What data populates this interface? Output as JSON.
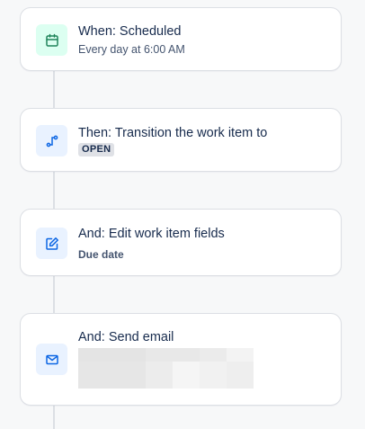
{
  "steps": [
    {
      "title": "When: Scheduled",
      "subtitle": "Every day at 6:00 AM",
      "icon": "calendar-icon",
      "icon_color": "#1f845a",
      "icon_bg": "#dcfff1"
    },
    {
      "title": "Then: Transition the work item to",
      "lozenge": "OPEN",
      "icon": "transition-icon",
      "icon_color": "#0c66e4",
      "icon_bg": "#e9f2ff"
    },
    {
      "title": "And: Edit work item fields",
      "subtitle": "Due date",
      "icon": "edit-icon",
      "icon_color": "#0c66e4",
      "icon_bg": "#e9f2ff"
    },
    {
      "title": "And: Send email",
      "icon": "email-icon",
      "icon_color": "#0c66e4",
      "icon_bg": "#e9f2ff"
    }
  ],
  "colors": {
    "card_border": "#dcdfe4",
    "connector": "#dcdfe4",
    "text": "#172b4d",
    "subtext": "#44546f"
  }
}
